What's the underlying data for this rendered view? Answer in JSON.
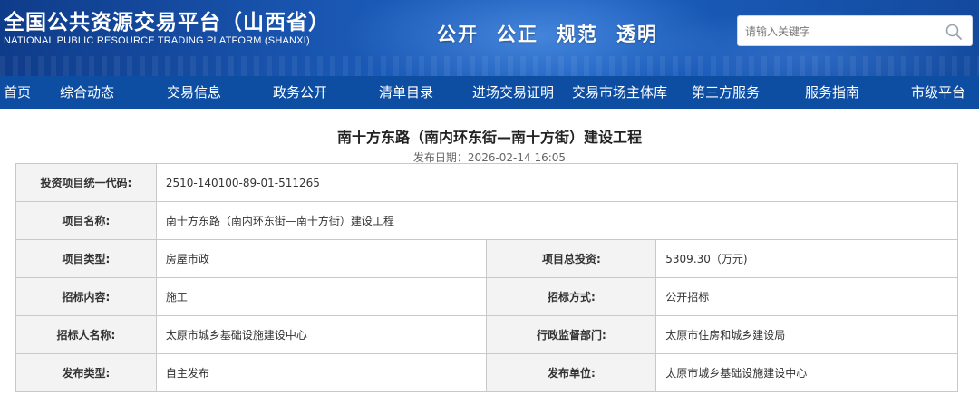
{
  "header": {
    "title_cn": "全国公共资源交易平台（山西省）",
    "title_en": "NATIONAL PUBLIC RESOURCE TRADING PLATFORM (SHANXI)",
    "slogan": [
      "公开",
      "公正",
      "规范",
      "透明"
    ]
  },
  "search": {
    "placeholder": "请输入关键字",
    "icon": "search-icon"
  },
  "nav": {
    "items": [
      "首页",
      "综合动态",
      "交易信息",
      "政务公开",
      "清单目录",
      "进场交易证明",
      "交易市场主体库",
      "第三方服务",
      "服务指南",
      "市级平台"
    ]
  },
  "article": {
    "title": "南十方东路（南内环东街—南十方街）建设工程",
    "publish_date": "发布日期：2026-02-14 16:05"
  },
  "info_table": {
    "code_label": "投资项目统一代码:",
    "code_value": "2510-140100-89-01-511265",
    "name_label": "项目名称:",
    "name_value": "南十方东路（南内环东街—南十方街）建设工程",
    "type_label": "项目类型:",
    "type_value": "房屋市政",
    "invest_label": "项目总投资:",
    "invest_value": "5309.30（万元)",
    "content_label": "招标内容:",
    "content_value": "施工",
    "method_label": "招标方式:",
    "method_value": "公开招标",
    "tenderer_label": "招标人名称:",
    "tenderer_value": "太原市城乡基础设施建设中心",
    "dept_label": "行政监督部门:",
    "dept_value": "太原市住房和城乡建设局",
    "pubtype_label": "发布类型:",
    "pubtype_value": "自主发布",
    "publisher_label": "发布单位:",
    "publisher_value": "太原市城乡基础设施建设中心"
  },
  "colors": {
    "nav_bg": "#0d4ea3",
    "header_bg": "#1a58b4",
    "label_bg": "#f3f3f3"
  }
}
